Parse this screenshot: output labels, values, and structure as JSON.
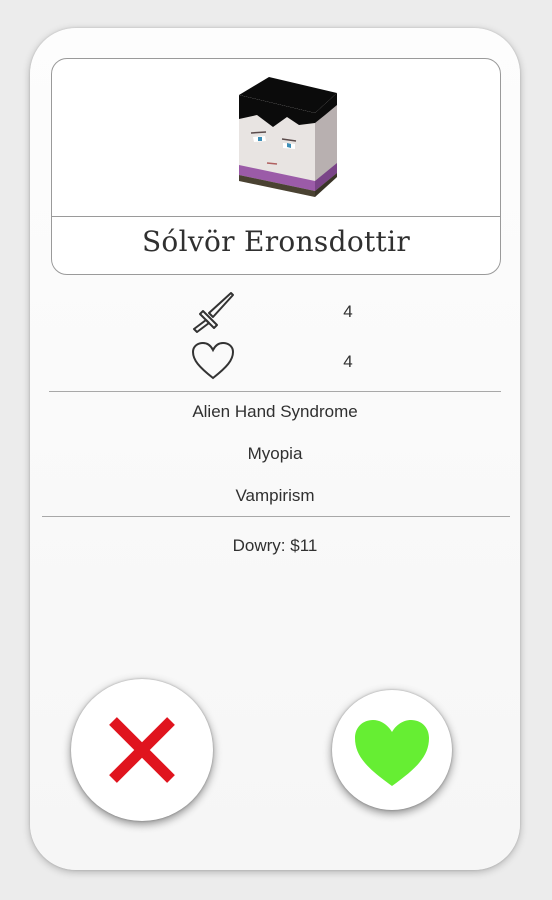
{
  "profile": {
    "name": "Sólvör Eronsdottir",
    "avatar": "cube-head-avatar"
  },
  "stats": {
    "attack": {
      "icon": "sword-icon",
      "value": "4"
    },
    "health": {
      "icon": "heart-outline-icon",
      "value": "4"
    }
  },
  "traits": [
    "Alien Hand Syndrome",
    "Myopia",
    "Vampirism"
  ],
  "dowry": "Dowry: $11",
  "actions": {
    "reject": {
      "icon": "red-x-icon",
      "color": "#e0141e"
    },
    "accept": {
      "icon": "green-heart-icon",
      "color": "#66ee33"
    }
  }
}
